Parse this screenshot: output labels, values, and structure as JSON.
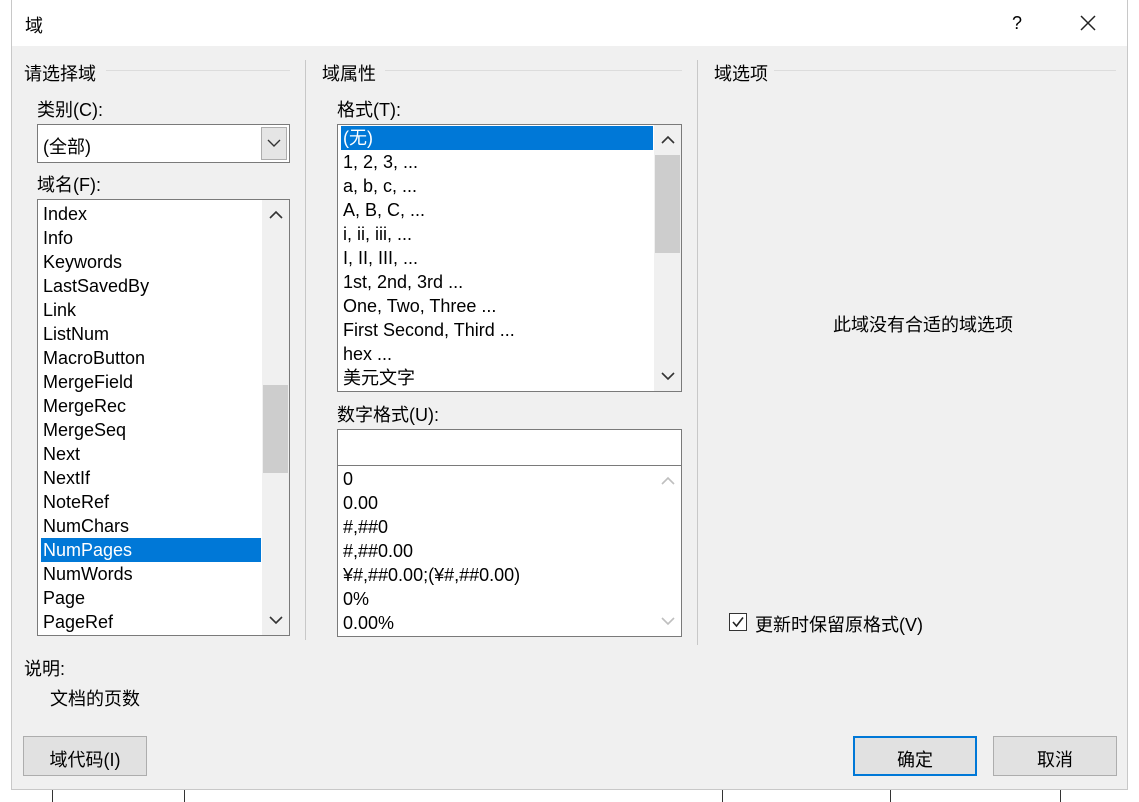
{
  "window": {
    "title": "域",
    "help_glyph": "?",
    "close_glyph": "close"
  },
  "select_field": {
    "group_title": "请选择域",
    "category_label": "类别(C):",
    "category_value": "(全部)",
    "fieldname_label": "域名(F):",
    "field_names": [
      "Index",
      "Info",
      "Keywords",
      "LastSavedBy",
      "Link",
      "ListNum",
      "MacroButton",
      "MergeField",
      "MergeRec",
      "MergeSeq",
      "Next",
      "NextIf",
      "NoteRef",
      "NumChars",
      "NumPages",
      "NumWords",
      "Page",
      "PageRef"
    ],
    "selected_field": "NumPages"
  },
  "field_properties": {
    "group_title": "域属性",
    "format_label": "格式(T):",
    "formats": [
      "(无)",
      "1, 2, 3, ...",
      "a, b, c, ...",
      "A, B, C, ...",
      "i, ii, iii, ...",
      "I, II, III, ...",
      "1st, 2nd, 3rd ...",
      "One, Two, Three ...",
      "First Second, Third ...",
      "hex ...",
      "美元文字"
    ],
    "selected_format": "(无)",
    "numformat_label": "数字格式(U):",
    "numformat_value": "",
    "numformats": [
      "0",
      "0.00",
      "#,##0",
      "#,##0.00",
      "¥#,##0.00;(¥#,##0.00)",
      "0%",
      "0.00%"
    ]
  },
  "field_options": {
    "group_title": "域选项",
    "no_options_text": "此域没有合适的域选项",
    "preserve_format_label": "更新时保留原格式(V)",
    "preserve_format_checked": true
  },
  "description": {
    "label": "说明:",
    "text": "文档的页数"
  },
  "buttons": {
    "field_codes": "域代码(I)",
    "ok": "确定",
    "cancel": "取消"
  },
  "colors": {
    "selection": "#0078d7",
    "dialog_bg": "#f0f0f0",
    "default_button_border": "#0078d7"
  }
}
